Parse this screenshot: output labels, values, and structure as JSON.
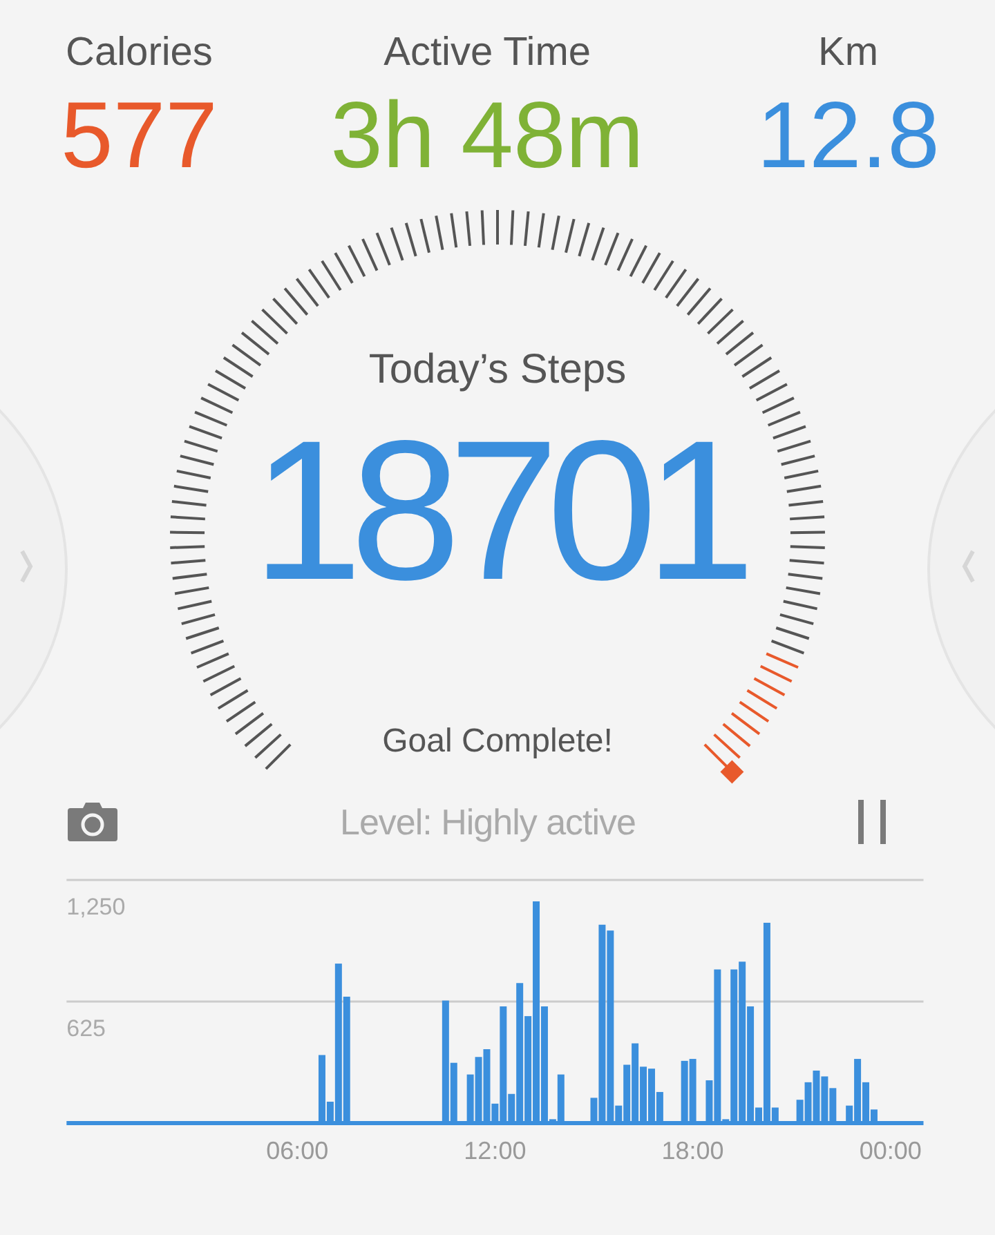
{
  "stats": [
    {
      "label": "Calories",
      "value": "577",
      "color": "#e8592b"
    },
    {
      "label": "Active Time",
      "value": "3h 48m",
      "color": "#7fb236"
    },
    {
      "label": "Km",
      "value": "12.8",
      "color": "#3b8fdd"
    }
  ],
  "steps": {
    "title": "Today’s Steps",
    "value": "18701",
    "status": "Goal Complete!",
    "goal_complete": true
  },
  "toolbar": {
    "level_text": "Level: Highly active"
  },
  "activity": {
    "chart_data": {
      "type": "bar",
      "x": [
        6.75,
        7,
        7.25,
        7.5,
        10.5,
        10.75,
        11.25,
        11.5,
        11.75,
        12,
        12.25,
        12.5,
        12.75,
        13,
        13.25,
        13.5,
        13.75,
        14,
        15,
        15.25,
        15.5,
        15.75,
        16,
        16.25,
        16.5,
        16.75,
        17,
        17.75,
        18,
        18.5,
        18.75,
        19,
        19.25,
        19.5,
        19.75,
        20,
        20.25,
        20.5,
        21.25,
        21.5,
        21.75,
        22,
        22.25,
        22.75,
        23,
        23.25,
        23.5
      ],
      "series": [
        {
          "color": "#3b8fdd",
          "values": [
            350,
            110,
            820,
            650,
            630,
            310,
            250,
            340,
            380,
            100,
            600,
            150,
            720,
            550,
            1140,
            600,
            20,
            250,
            130,
            1020,
            990,
            90,
            300,
            410,
            290,
            280,
            160,
            320,
            330,
            220,
            790,
            20,
            790,
            830,
            600,
            80,
            1030,
            80,
            120,
            210,
            270,
            240,
            180,
            90,
            330,
            210,
            70
          ]
        }
      ],
      "xlim": [
        -1,
        25
      ],
      "ylim": [
        0,
        1250
      ],
      "xticks": [
        {
          "value": 6,
          "label": "06:00"
        },
        {
          "value": 12,
          "label": "12:00"
        },
        {
          "value": 18,
          "label": "18:00"
        },
        {
          "value": 24,
          "label": "00:00"
        }
      ],
      "yticks": [
        {
          "value": 625,
          "label": "625"
        },
        {
          "value": 1250,
          "label": "1,250"
        }
      ]
    }
  }
}
